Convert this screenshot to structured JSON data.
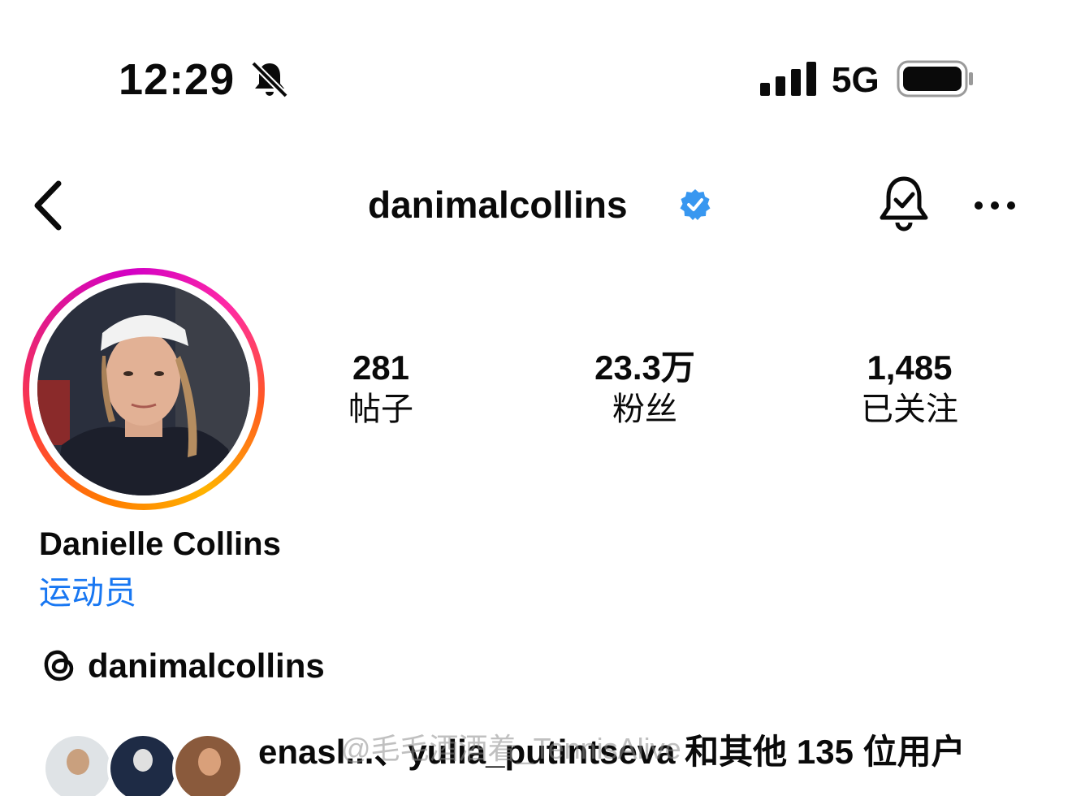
{
  "status_bar": {
    "time": "12:29",
    "network": "5G",
    "icons": [
      "bell-slash-icon",
      "cellular-signal-icon",
      "battery-icon"
    ]
  },
  "header": {
    "username": "danimalcollins",
    "icons": [
      "back-chevron-icon",
      "verified-badge-icon",
      "notification-bell-icon",
      "more-horizontal-icon"
    ],
    "verified_color": "#3897f0"
  },
  "profile": {
    "avatar_ring_colors": [
      "#ffb300",
      "#ff5a1f",
      "#e21b8a",
      "#d300c5"
    ],
    "stats": [
      {
        "value": "281",
        "label": "帖子"
      },
      {
        "value": "23.3万",
        "label": "粉丝"
      },
      {
        "value": "1,485",
        "label": "已关注"
      }
    ],
    "full_name": "Danielle Collins",
    "category": "运动员",
    "category_color": "#1877f2",
    "threads_handle": "danimalcollins"
  },
  "mutual_followers": {
    "text": "enasl...、yulia_putintseva 和其他 135 位用户",
    "watermark": "@毛毛酒酒着_TennisAlive"
  }
}
